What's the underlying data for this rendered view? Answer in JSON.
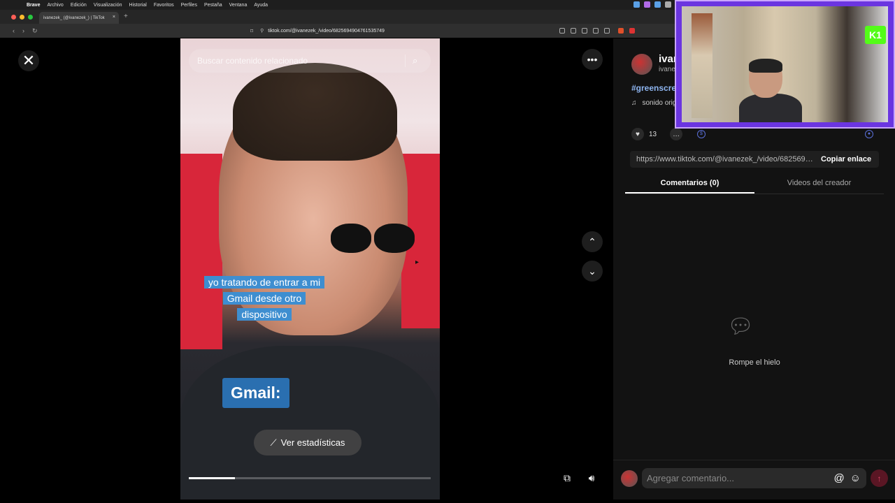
{
  "menubar": {
    "items": [
      "Brave",
      "Archivo",
      "Edición",
      "Visualización",
      "Historial",
      "Favoritos",
      "Perfiles",
      "Pestaña",
      "Ventana",
      "Ayuda"
    ]
  },
  "browser": {
    "tab_title": "ivanezek_ (@ivanezek_) | TikTok",
    "url": "tiktok.com/@ivanezek_/video/6825694904761535749"
  },
  "video": {
    "search_placeholder": "Buscar contenido relacionado",
    "caption_lines": [
      "yo tratando de entrar a mi",
      "Gmail desde otro",
      "dispositivo"
    ],
    "overlay_label": "Gmail:",
    "stats_button": "Ver estadísticas",
    "progress": 0.19
  },
  "creator": {
    "name": "ivanezek_",
    "handle": "ivanezek_",
    "hashtag": "#greenscreen",
    "sound": "sonido original"
  },
  "actions": {
    "likes": "13"
  },
  "share": {
    "link": "https://www.tiktok.com/@ivanezek_/video/6825694904761535749",
    "copy_label": "Copiar enlace"
  },
  "tabs": {
    "comments": "Comentarios (0)",
    "creator_videos": "Videos del creador"
  },
  "empty_state": {
    "text": "Rompe el hielo"
  },
  "comment_box": {
    "placeholder": "Agregar comentario..."
  },
  "colors": {
    "accent_purple": "#6b35e0",
    "tiktok_red": "#fe2c55",
    "hashtag_blue": "#8eb5f0",
    "caption_blue": "#3e8ed0"
  },
  "icons": {
    "close": "close-icon",
    "more": "more-horizontal-icon",
    "up": "chevron-up-icon",
    "down": "chevron-down-icon",
    "volume": "volume-icon",
    "like": "heart-icon",
    "comment": "comment-icon",
    "send": "send-icon"
  }
}
